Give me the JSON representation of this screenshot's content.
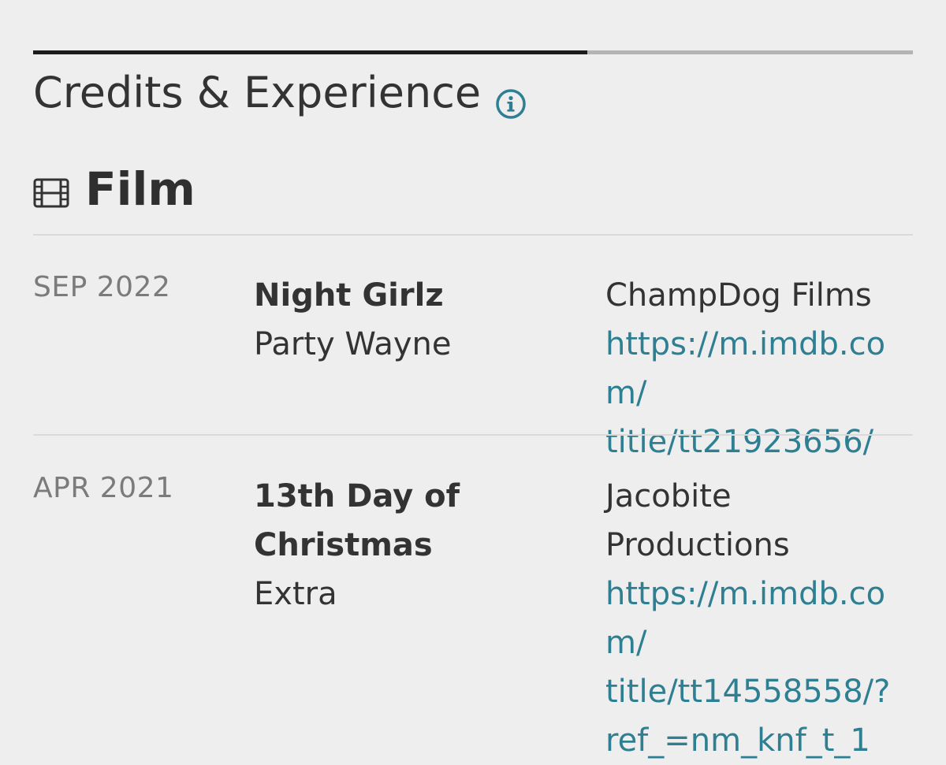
{
  "tabs": {
    "progress": 0.63
  },
  "section": {
    "title": "Credits & Experience",
    "info_icon": "info-circle-icon",
    "accent_color": "#2f7f93"
  },
  "category": {
    "icon": "film-strip-icon",
    "label": "Film"
  },
  "credits": [
    {
      "date": "SEP 2022",
      "title": "Night Girlz",
      "role": "Party Wayne",
      "production": "ChampDog Films",
      "link_lines": [
        "https://m.imdb.com/",
        "title/tt21923656/"
      ]
    },
    {
      "date": "APR 2021",
      "title_lines": [
        "13th Day of",
        "Christmas"
      ],
      "role": "Extra",
      "production_lines": [
        "Jacobite",
        "Productions"
      ],
      "link_lines": [
        "https://m.imdb.com/",
        "title/tt14558558/?",
        "ref_=nm_knf_t_1"
      ]
    }
  ]
}
